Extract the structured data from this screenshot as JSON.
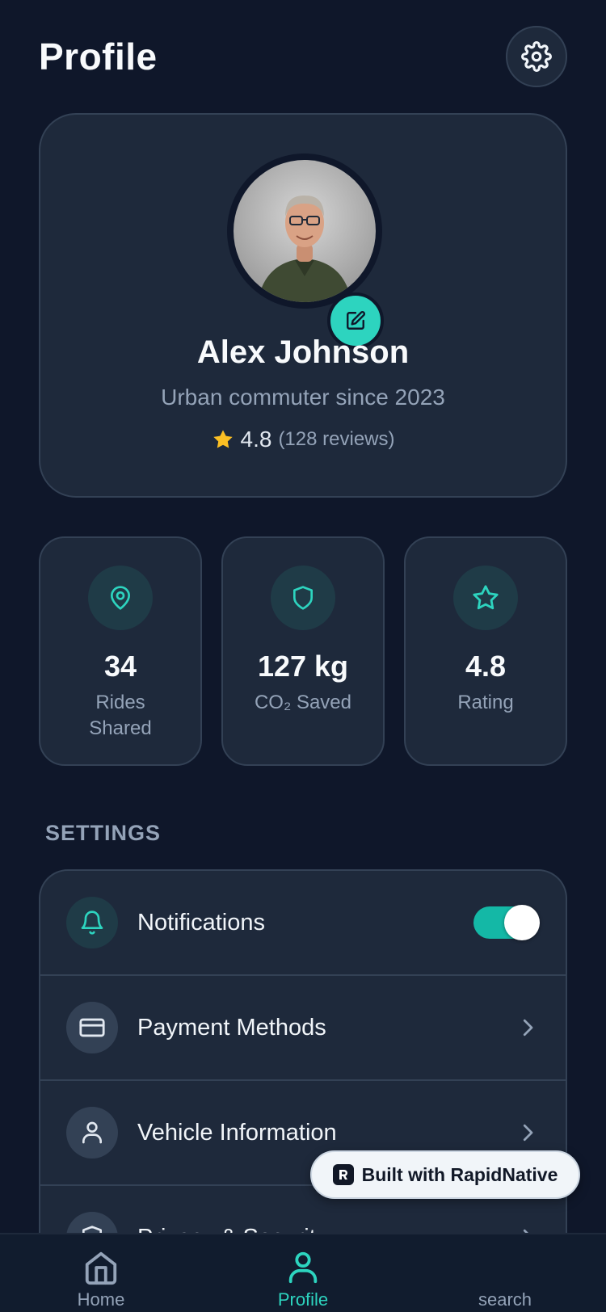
{
  "header": {
    "title": "Profile"
  },
  "profile": {
    "name": "Alex Johnson",
    "subtitle": "Urban commuter since 2023",
    "rating": "4.8",
    "reviews": "(128 reviews)"
  },
  "stats": [
    {
      "icon": "map-pin-icon",
      "value": "34",
      "label": "Rides Shared"
    },
    {
      "icon": "shield-icon",
      "value": "127 kg",
      "label": "CO₂ Saved"
    },
    {
      "icon": "star-icon",
      "value": "4.8",
      "label": "Rating"
    }
  ],
  "settings": {
    "section_label": "SETTINGS",
    "items": [
      {
        "label": "Notifications",
        "icon": "bell-icon",
        "control": "toggle",
        "enabled": true
      },
      {
        "label": "Payment Methods",
        "icon": "credit-card-icon",
        "control": "chevron"
      },
      {
        "label": "Vehicle Information",
        "icon": "user-icon",
        "control": "chevron"
      },
      {
        "label": "Privacy & Security",
        "icon": "shield-icon",
        "control": "chevron"
      }
    ]
  },
  "badge": {
    "text": "Built with RapidNative"
  },
  "tabs": [
    {
      "label": "Home",
      "icon": "home-icon",
      "active": false
    },
    {
      "label": "Profile",
      "icon": "user-icon",
      "active": true
    },
    {
      "label": "search",
      "icon": "search-icon",
      "active": false
    }
  ],
  "colors": {
    "background": "#0f172a",
    "card": "#1e293b",
    "accent": "#2dd4bf",
    "star": "#fbbf24"
  }
}
